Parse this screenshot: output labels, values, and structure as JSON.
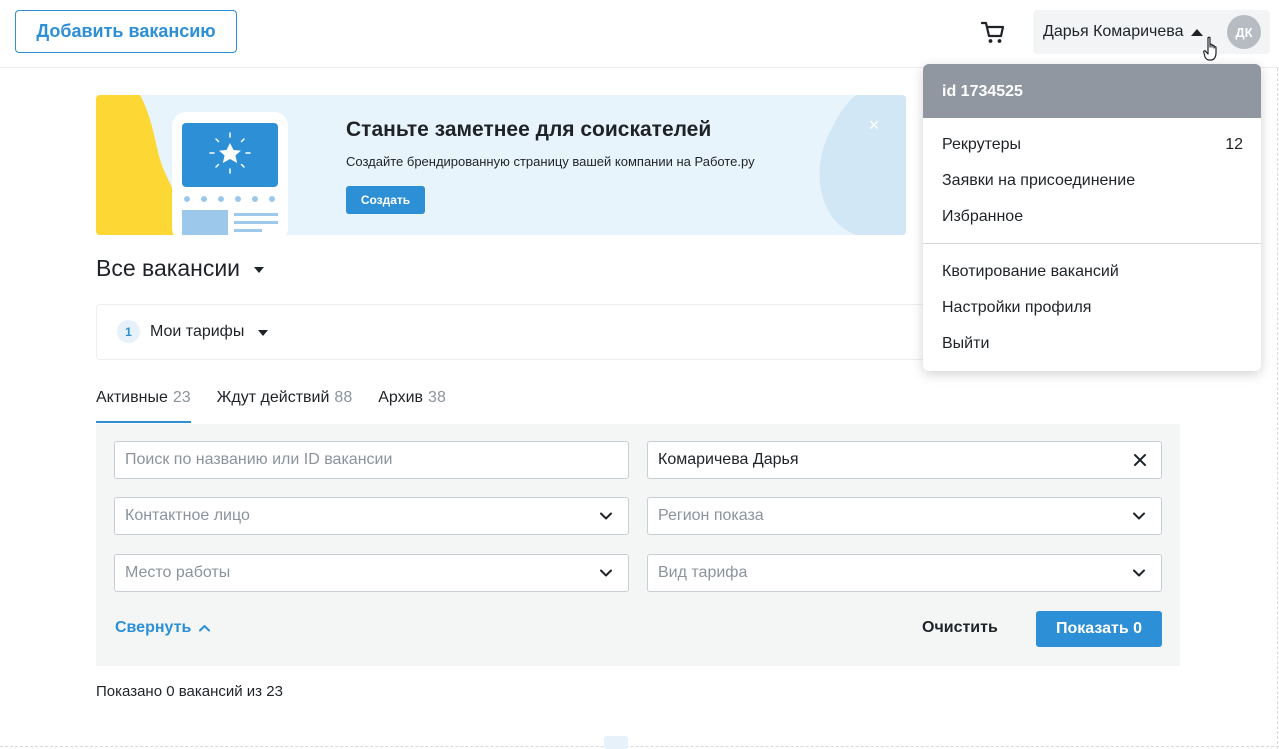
{
  "header": {
    "add_vacancy": "Добавить вакансию",
    "user_name": "Дарья Комаричева",
    "avatar_initials": "ДК"
  },
  "banner": {
    "title": "Станьте заметнее для соискателей",
    "subtitle": "Создайте брендированную страницу вашей компании на Работе.ру",
    "button": "Создать",
    "close": "×"
  },
  "page": {
    "heading": "Все вакансии",
    "tariffs_count": "1",
    "tariffs_label": "Мои тарифы"
  },
  "tabs": [
    {
      "label": "Активные",
      "count": "23"
    },
    {
      "label": "Ждут действий",
      "count": "88"
    },
    {
      "label": "Архив",
      "count": "38"
    }
  ],
  "filters": {
    "search_placeholder": "Поиск по названию или ID вакансии",
    "recruiter_value": "Комаричева Дарья",
    "contact_placeholder": "Контактное лицо",
    "region_placeholder": "Регион показа",
    "workplace_placeholder": "Место работы",
    "tariff_placeholder": "Вид тарифа",
    "collapse": "Свернуть",
    "clear": "Очистить",
    "show": "Показать 0"
  },
  "summary": "Показано 0 вакансий из 23",
  "dropdown": {
    "id": "id 1734525",
    "items": [
      {
        "label": "Рекрутеры",
        "count": "12"
      },
      {
        "label": "Заявки на присоединение"
      },
      {
        "label": "Избранное"
      },
      {
        "label": "Квотирование вакансий"
      },
      {
        "label": "Настройки профиля"
      },
      {
        "label": "Выйти"
      }
    ]
  },
  "colors": {
    "accent": "#2d8fd5",
    "banner_yellow": "#fdd835",
    "dropdown_header": "#9097a0"
  }
}
